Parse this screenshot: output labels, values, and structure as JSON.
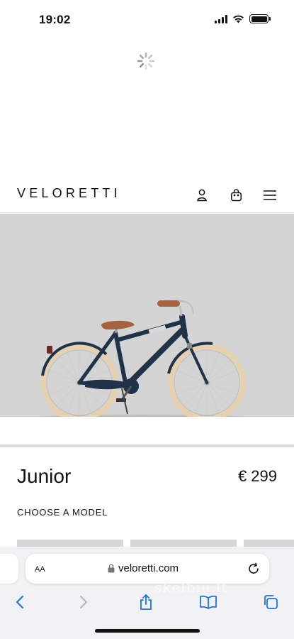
{
  "status_bar": {
    "time": "19:02",
    "icons": [
      "cellular-signal-icon",
      "wifi-icon",
      "battery-icon"
    ]
  },
  "loading": {
    "icon": "loading-spinner-icon"
  },
  "site": {
    "logo": "VELORETTI",
    "header_icons": [
      "account-icon",
      "cart-icon",
      "menu-icon"
    ]
  },
  "hero": {
    "image": "junior-bike-navy-product-photo",
    "background_color": "#d4d4d4"
  },
  "product": {
    "name": "Junior",
    "price": "€ 299",
    "choose_label": "CHOOSE A MODEL"
  },
  "browser": {
    "text_size_button": "AA",
    "url": "veloretti.com",
    "lock_icon": "lock-icon",
    "reload_icon": "reload-icon",
    "toolbar_icons": [
      "back-icon",
      "forward-icon",
      "share-icon",
      "bookmarks-icon",
      "tabs-icon"
    ],
    "watermark": "skelbiu.lt"
  },
  "colors": {
    "accent_blue": "#1a73e8",
    "text": "#111111",
    "bike_frame": "#1f3247",
    "tire_cream": "#e8d3b0",
    "saddle_brown": "#a5643f"
  }
}
